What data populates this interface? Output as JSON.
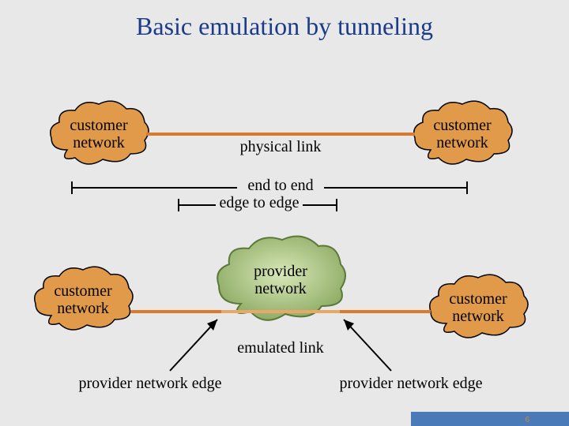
{
  "title": "Basic emulation by tunneling",
  "clouds": {
    "top_left": "customer\nnetwork",
    "top_right": "customer\nnetwork",
    "bottom_left": "customer\nnetwork",
    "bottom_right": "customer\nnetwork",
    "provider": "provider\nnetwork"
  },
  "labels": {
    "physical_link": "physical link",
    "end_to_end": "end to end",
    "edge_to_edge": "edge to edge",
    "emulated_link": "emulated link",
    "provider_edge_left": "provider network edge",
    "provider_edge_right": "provider network edge"
  },
  "colors": {
    "cloud_customer": "#e09a4a",
    "cloud_provider_fill": "#b8d090",
    "title": "#1a3a8a",
    "link": "#d97a2e"
  },
  "page_number": "6"
}
